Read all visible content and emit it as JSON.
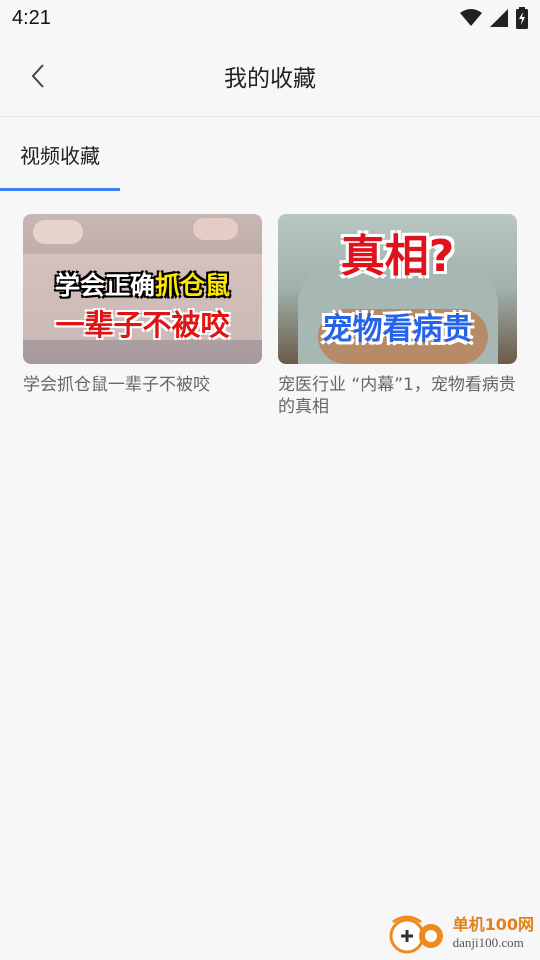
{
  "status_bar": {
    "time": "4:21",
    "icons": [
      "wifi-icon",
      "signal-icon",
      "battery-charging-icon"
    ]
  },
  "header": {
    "back_icon": "chevron-left-icon",
    "title": "我的收藏"
  },
  "tabs": [
    {
      "label": "视频收藏",
      "active": true
    }
  ],
  "accent_color": "#3b82f6",
  "videos": [
    {
      "thumbnail_line1_a": "学会正确",
      "thumbnail_line1_b": "抓仓鼠",
      "thumbnail_line2": "一辈子不被咬",
      "title": "学会抓仓鼠一辈子不被咬"
    },
    {
      "thumbnail_line1": "真相?",
      "thumbnail_line2": "宠物看病贵",
      "title": "宠医行业 “内幕”1，宠物看病贵的真相"
    }
  ],
  "watermark": {
    "brand": "单机100网",
    "url": "danji100.com"
  }
}
